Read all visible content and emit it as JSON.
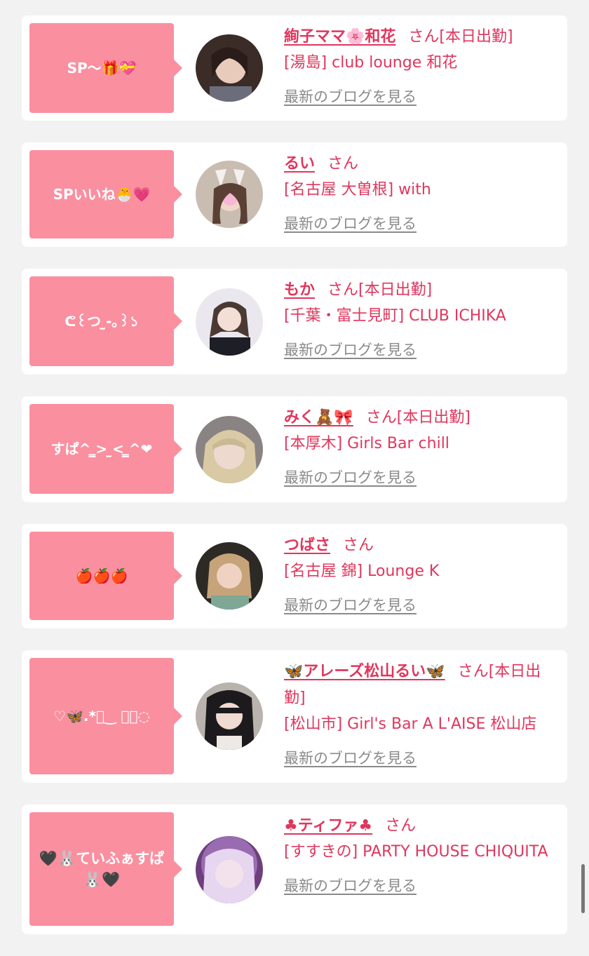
{
  "entries": [
    {
      "bubble": "SP〜🎁💝",
      "name": "絢子ママ🌸和花",
      "suffix": "さん[本日出勤]",
      "shop": "[湯島] club lounge 和花",
      "blog": "最新のブログを見る"
    },
    {
      "bubble": "SPいいね🐣💗",
      "name": "るい",
      "suffix": "さん",
      "shop": "[名古屋 大曽根] with",
      "blog": "最新のブログを見る"
    },
    {
      "bubble": "ᕦ꒰つ ̫-｡꒱১",
      "name": "もか",
      "suffix": "さん[本日出勤]",
      "shop": "[千葉・富士見町] CLUB ICHIKA",
      "blog": "最新のブログを見る"
    },
    {
      "bubble": "すぱ^ ̳> ̫< ̳^❤",
      "name": "みく🧸🎀",
      "suffix": "さん[本日出勤]",
      "shop": "[本厚木] Girls Bar chill",
      "blog": "最新のブログを見る"
    },
    {
      "bubble": "🍎🍎🍎",
      "name": "つばさ",
      "suffix": "さん",
      "shop": "[名古屋 錦] Lounge K",
      "blog": "最新のブログを見る"
    },
    {
      "bubble": "♡🦋.*ﾟ‿ ｡ﾟ◌",
      "name": "🦋アレーズ松山るい🦋",
      "suffix": "さん[本日出勤]",
      "shop": "[松山市] Girl's Bar A L'AISE 松山店",
      "blog": "最新のブログを見る"
    },
    {
      "bubble": "🖤🐰ていふぁすぱ🐰🖤",
      "name": "♣︎ティファ♣︎",
      "suffix": "さん",
      "shop": "[すすきの] PARTY HOUSE CHIQUITA",
      "blog": "最新のブログを見る"
    }
  ],
  "colors": {
    "accent": "#e0365d",
    "bubble": "#fa8fa0",
    "background": "#f2f2f2"
  }
}
